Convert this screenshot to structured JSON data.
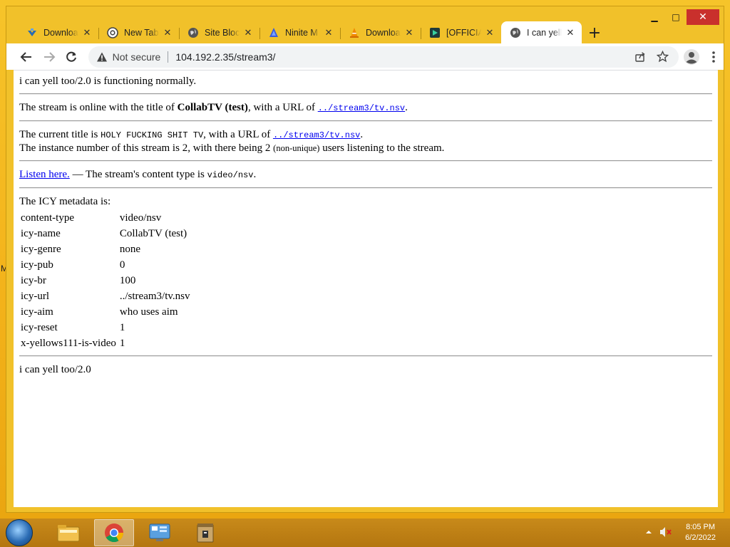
{
  "desktop": {
    "edge_letter": "M"
  },
  "window": {
    "controls": {
      "minimize": "▁",
      "maximize": "□",
      "close": "✕"
    },
    "tabs": [
      {
        "title": "Downloads",
        "icon": "download-arrow-icon"
      },
      {
        "title": "New Tab",
        "icon": "chrome-icon"
      },
      {
        "title": "Site Blocker",
        "icon": "globe-icon"
      },
      {
        "title": "Ninite M",
        "icon": "ninite-icon"
      },
      {
        "title": "Downloads",
        "icon": "vlc-cone-icon"
      },
      {
        "title": "[OFFICIAL",
        "icon": "app-icon"
      },
      {
        "title": "I can yell",
        "icon": "globe-icon",
        "active": true
      }
    ],
    "new_tab": "+"
  },
  "toolbar": {
    "security_label": "Not secure",
    "url": "104.192.2.35/stream3/"
  },
  "page": {
    "status_line": "i can yell too/2.0 is functioning normally.",
    "stream": {
      "prefix": "The stream is online with the title of ",
      "title": "CollabTV (test)",
      "mid": ", with a URL of ",
      "url": "../stream3/tv.nsv",
      "end": "."
    },
    "current": {
      "prefix": "The current title is ",
      "title": "HOLY FUCKING SHIT TV",
      "mid": ", with a URL of ",
      "url": "../stream3/tv.nsv",
      "end": "."
    },
    "instance": {
      "prefix": "The instance number of this stream is 2, with there being 2 ",
      "nonunique": "(non-unique)",
      "end": " users listening to the stream."
    },
    "listen": {
      "link": "Listen here.",
      "text": " — The stream's content type is ",
      "type": "video/nsv",
      "end": "."
    },
    "icy_intro": "The ICY metadata is:",
    "icy": [
      {
        "key": "content-type",
        "value": "video/nsv"
      },
      {
        "key": "icy-name",
        "value": "CollabTV (test)"
      },
      {
        "key": "icy-genre",
        "value": "none"
      },
      {
        "key": "icy-pub",
        "value": "0"
      },
      {
        "key": "icy-br",
        "value": "100"
      },
      {
        "key": "icy-url",
        "value": "../stream3/tv.nsv"
      },
      {
        "key": "icy-aim",
        "value": "who uses aim"
      },
      {
        "key": "icy-reset",
        "value": "1"
      },
      {
        "key": "x-yellows111-is-video",
        "value": "1"
      }
    ],
    "footer": "i can yell too/2.0"
  },
  "taskbar": {
    "apps": [
      {
        "name": "file-explorer-icon"
      },
      {
        "name": "chrome-icon",
        "active": true
      },
      {
        "name": "control-panel-icon"
      },
      {
        "name": "archive-app-icon"
      }
    ],
    "time": "8:05 PM",
    "date": "6/2/2022"
  }
}
